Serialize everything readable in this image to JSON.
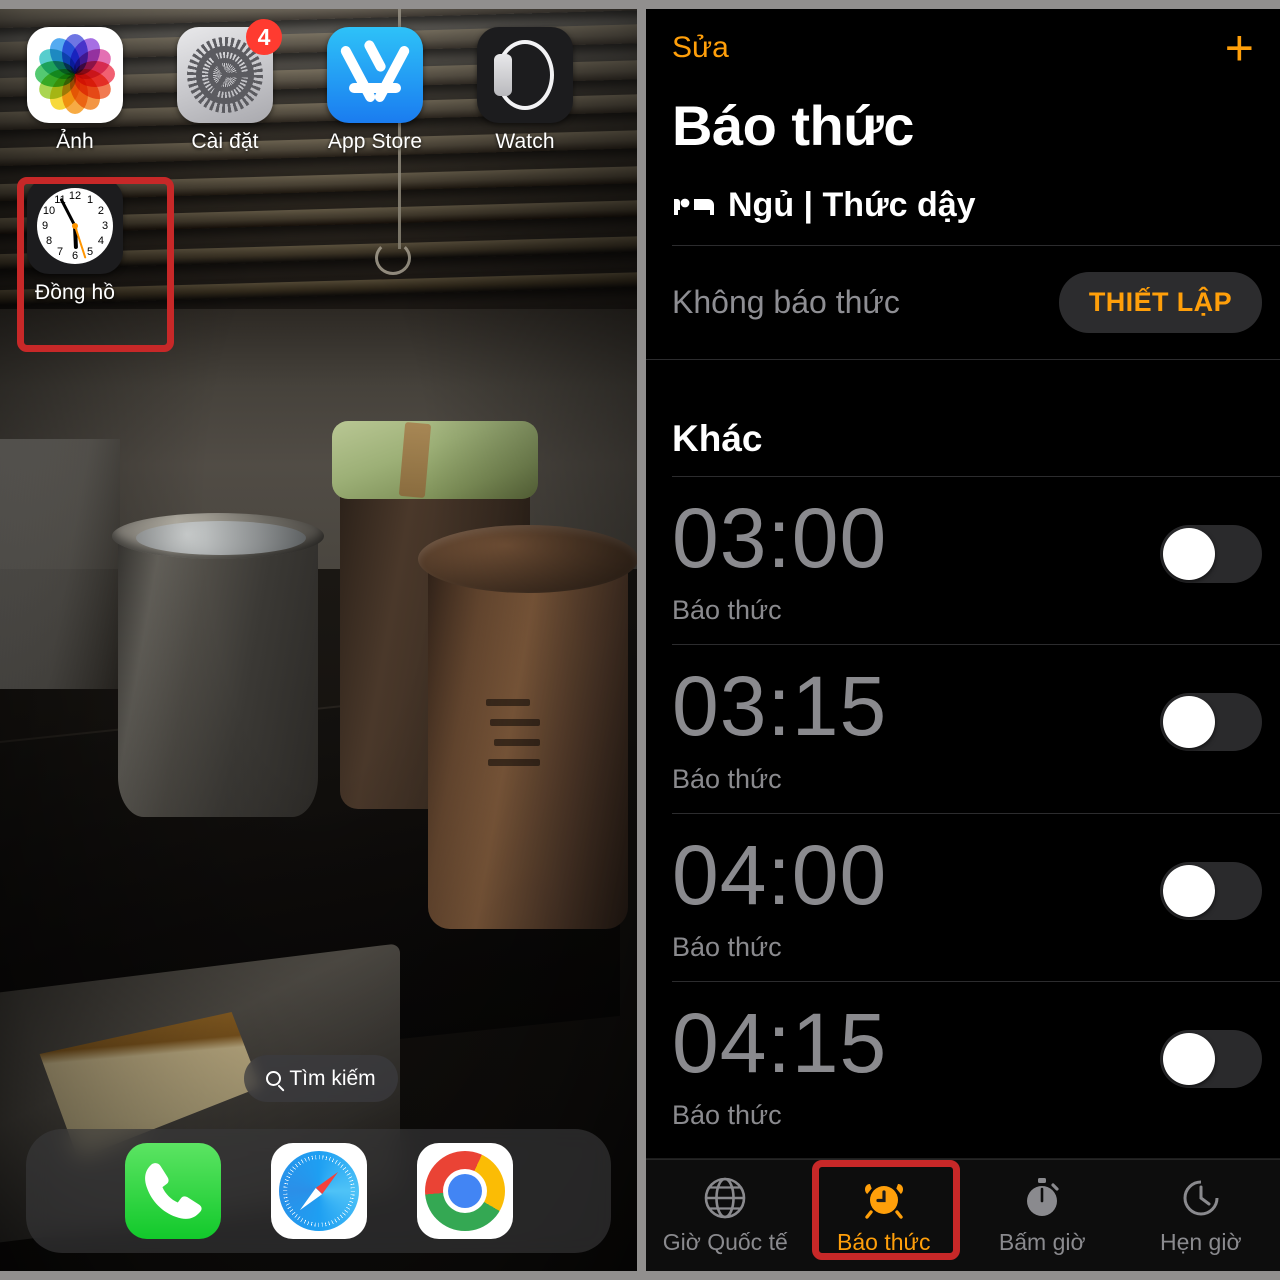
{
  "home_screen": {
    "apps": [
      {
        "label": "Ảnh",
        "icon": "photos-icon"
      },
      {
        "label": "Cài đặt",
        "icon": "settings-gear-icon",
        "badge": "4"
      },
      {
        "label": "App Store",
        "icon": "app-store-icon"
      },
      {
        "label": "Watch",
        "icon": "watch-icon"
      },
      {
        "label": "Đồng hồ",
        "icon": "clock-icon",
        "highlighted": true
      }
    ],
    "search_pill": {
      "label": "Tìm kiếm",
      "icon": "search-icon"
    },
    "dock": [
      {
        "label": "Phone",
        "icon": "phone-icon"
      },
      {
        "label": "Safari",
        "icon": "safari-compass-icon"
      },
      {
        "label": "Chrome",
        "icon": "chrome-icon"
      }
    ],
    "clock_icon_time": {
      "hour": 5,
      "minute": 55,
      "second": 27
    }
  },
  "clock_app": {
    "nav": {
      "edit_label": "Sửa",
      "add_label": "+"
    },
    "title": "Báo thức",
    "sleep_section": {
      "icon": "bed-icon",
      "heading": "Ngủ | Thức dậy",
      "status": "Không báo thức",
      "action_label": "THIẾT LẬP"
    },
    "other_section": {
      "heading": "Khác",
      "alarms": [
        {
          "time": "03:00",
          "label": "Báo thức",
          "enabled": false
        },
        {
          "time": "03:15",
          "label": "Báo thức",
          "enabled": false
        },
        {
          "time": "04:00",
          "label": "Báo thức",
          "enabled": false
        },
        {
          "time": "04:15",
          "label": "Báo thức",
          "enabled": false
        }
      ]
    },
    "tabs": [
      {
        "label": "Giờ Quốc tế",
        "icon": "globe-icon",
        "active": false
      },
      {
        "label": "Báo thức",
        "icon": "alarm-clock-icon",
        "active": true,
        "highlighted": true
      },
      {
        "label": "Bấm giờ",
        "icon": "stopwatch-icon",
        "active": false
      },
      {
        "label": "Hẹn giờ",
        "icon": "timer-icon",
        "active": false
      }
    ]
  },
  "colors": {
    "accent_orange": "#ff9f0a",
    "highlight_red": "#c72828",
    "inactive_gray": "#8a8a8e",
    "background_black": "#000000",
    "frame_gray": "#918f8e"
  }
}
